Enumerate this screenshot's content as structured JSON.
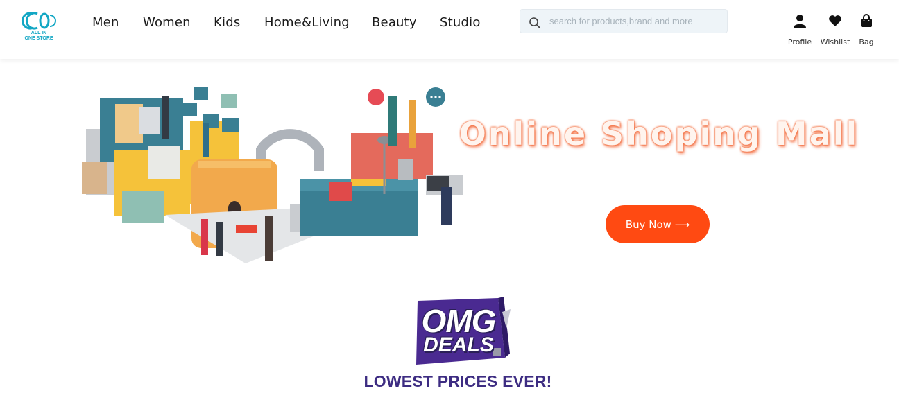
{
  "brand": {
    "logo_text": "ALL IN\nONE STORE",
    "logo_color": "#13a7c4"
  },
  "nav": {
    "items": [
      {
        "label": "Men"
      },
      {
        "label": "Women"
      },
      {
        "label": "Kids"
      },
      {
        "label": "Home&Living"
      },
      {
        "label": "Beauty"
      },
      {
        "label": "Studio"
      }
    ]
  },
  "search": {
    "placeholder": "search for products,brand and more",
    "value": "",
    "icon": "search-icon"
  },
  "actions": [
    {
      "label": "Profile",
      "icon": "user-icon"
    },
    {
      "label": "Wishlist",
      "icon": "heart-icon"
    },
    {
      "label": "Bag",
      "icon": "shopping-bag-icon"
    }
  ],
  "hero": {
    "title": "Online Shoping Mall",
    "cta_label": "Buy Now ⟶",
    "accent_color": "#ff4a12"
  },
  "promo": {
    "badge_line1": "OMG",
    "badge_line2": "DEALS",
    "tagline": "LOWEST PRICES EVER!",
    "brand_color": "#3d2c82"
  }
}
